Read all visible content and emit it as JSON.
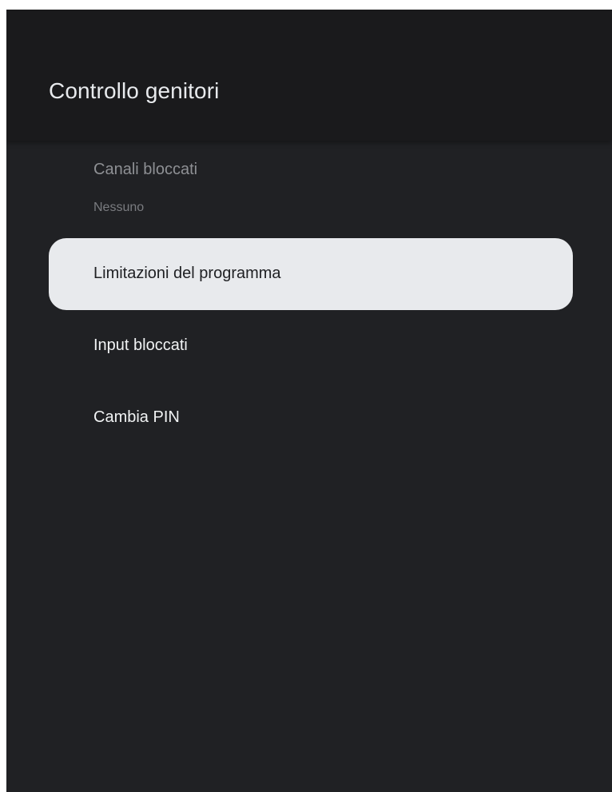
{
  "header": {
    "title": "Controllo genitori"
  },
  "menu": {
    "items": [
      {
        "label": "Canali bloccati",
        "sublabel": "Nessuno",
        "state": "disabled"
      },
      {
        "label": "Limitazioni del programma",
        "state": "focused"
      },
      {
        "label": "Input bloccati",
        "state": "normal"
      },
      {
        "label": "Cambia PIN",
        "state": "normal"
      }
    ]
  },
  "colors": {
    "background": "#202124",
    "header_background": "#1a1a1c",
    "focus_highlight": "#e8eaed",
    "text_primary": "#f1f3f4",
    "text_disabled": "#8e9094"
  }
}
